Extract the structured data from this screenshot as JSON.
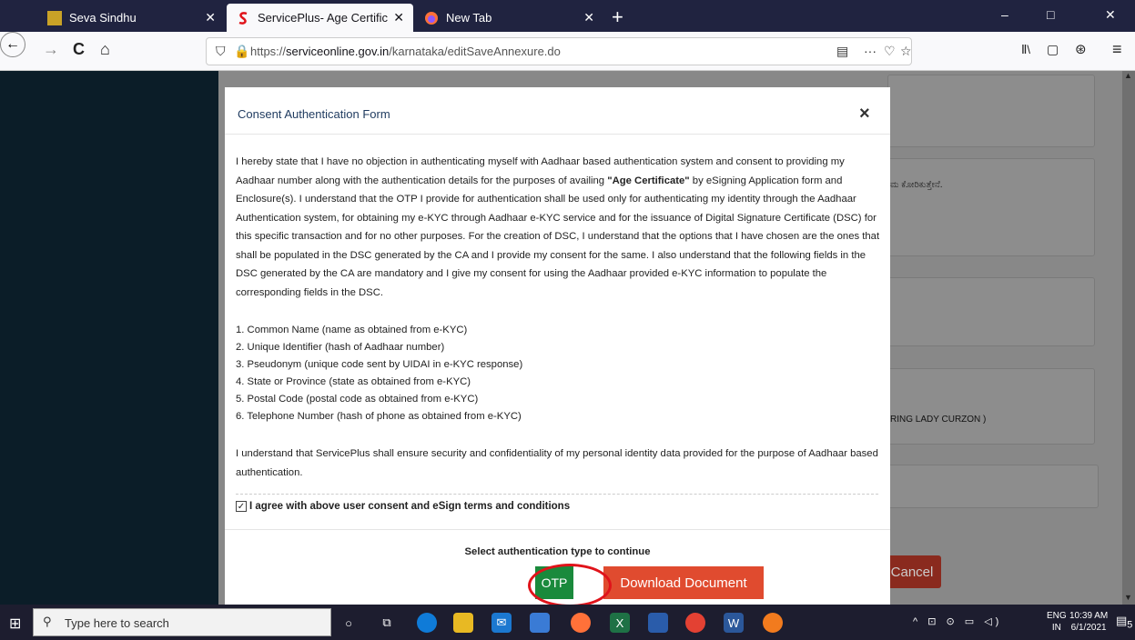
{
  "browser": {
    "tabs": [
      {
        "title": "Seva Sindhu",
        "icon": "seva-sindhu-icon"
      },
      {
        "title": "ServicePlus- Age Certificate",
        "icon": "serviceplus-icon"
      },
      {
        "title": "New Tab",
        "icon": "firefox-icon"
      }
    ],
    "new_tab": "+",
    "window_controls": {
      "minimize": "–",
      "maximize": "□",
      "close": "✕"
    },
    "nav": {
      "back": "←",
      "forward": "→",
      "reload": "C",
      "home": "⌂"
    },
    "url": {
      "prefix": "https://",
      "domain": "serviceonline.gov.in",
      "path": "/karnataka/editSaveAnnexure.do"
    },
    "url_icons": {
      "reader": "▤",
      "more": "···",
      "pocket": "♡",
      "bookmark": "☆"
    },
    "toolbar_icons": {
      "library": "Ⅱ\\",
      "sidebar": "▢",
      "account": "⊛",
      "menu": "≡"
    }
  },
  "background_page": {
    "kannada_text": "ಮ ಕೋರಿಕುತ್ತೇನೆ.",
    "school_text": "RING LADY CURZON )",
    "cancel_label": "Cancel"
  },
  "modal": {
    "title": "Consent Authentication Form",
    "close_label": "×",
    "consent_before": "I hereby state that I have no objection in authenticating myself with Aadhaar based authentication system and consent to providing my Aadhaar number along with the authentication details for the purposes of availing ",
    "consent_service": "\"Age Certificate\"",
    "consent_after": " by eSigning Application form and Enclosure(s). I understand that the OTP I provide for authentication shall be used only for authenticating my identity through the Aadhaar Authentication system, for obtaining my e-KYC through Aadhaar e-KYC service and for the issuance of Digital Signature Certificate (DSC) for this specific transaction and for no other purposes. For the creation of DSC, I understand that the options that I have chosen are the ones that shall be populated in the DSC generated by the CA and I provide my consent for the same. I also understand that the following fields in the DSC generated by the CA are mandatory and I give my consent for using the Aadhaar provided e-KYC information to populate the corresponding fields in the DSC.",
    "fields": [
      "1. Common Name (name as obtained from e-KYC)",
      "2. Unique Identifier (hash of Aadhaar number)",
      "3. Pseudonym (unique code sent by UIDAI in e-KYC response)",
      "4. State or Province (state as obtained from e-KYC)",
      "5. Postal Code (postal code as obtained from e-KYC)",
      "6. Telephone Number (hash of phone as obtained from e-KYC)"
    ],
    "security_text": "I understand that ServicePlus shall ensure security and confidentiality of my personal identity data provided for the purpose of Aadhaar based authentication.",
    "agree_checked": true,
    "agree_label": "I agree with above user consent and eSign terms and conditions",
    "auth_prompt": "Select authentication type to continue",
    "otp_label": "OTP",
    "download_label": "Download Document"
  },
  "taskbar": {
    "search_placeholder": "Type here to search",
    "apps": [
      "cortana-icon",
      "task-view-icon",
      "edge-icon",
      "file-explorer-icon",
      "mail-icon",
      "store-icon",
      "firefox-icon",
      "excel-icon",
      "app-icon",
      "chrome-icon",
      "word-icon",
      "app-orange-icon"
    ],
    "tray": "^ ⊡ ⊙ ▭ ◁)",
    "lang_line1": "ENG",
    "lang_line2": "IN",
    "time": "10:39 AM",
    "date": "6/1/2021",
    "notifications": "5"
  },
  "colors": {
    "otp_button": "#1a8a3c",
    "download_button": "#e04b2f",
    "highlight": "#e0131a",
    "modal_title": "#1e3a5f"
  }
}
